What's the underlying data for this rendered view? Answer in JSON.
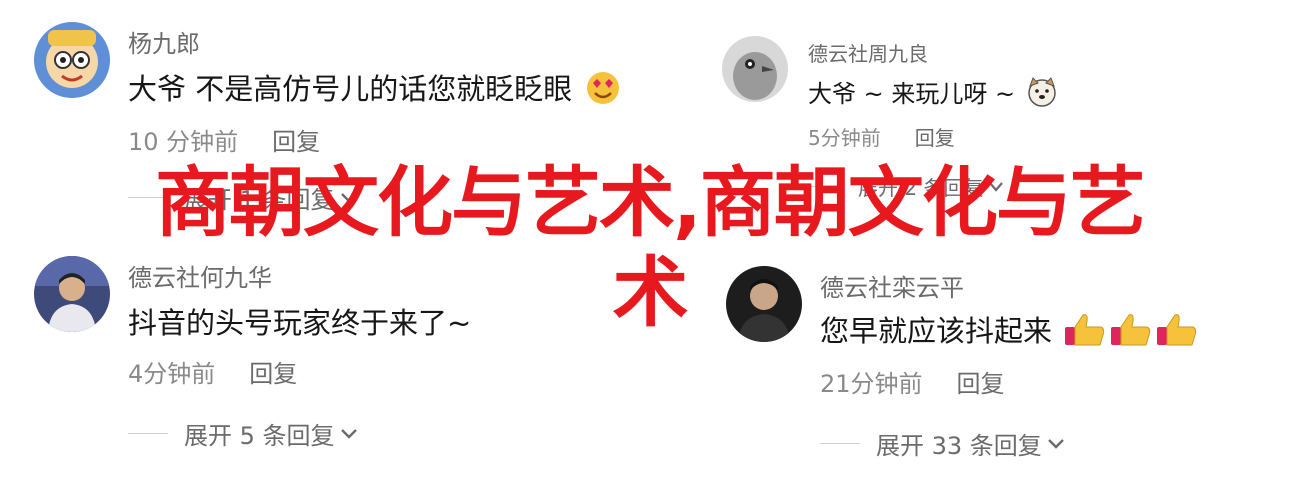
{
  "comments": [
    {
      "username": "杨九郎",
      "text": "大爷 不是高仿号儿的话您就眨眨眼",
      "emoji": "heart-eyes-emoji",
      "time": "10 分钟前",
      "reply": "回复",
      "expand": "展开 1 条回复"
    },
    {
      "username": "德云社周九良",
      "text": "大爷 ~ 来玩儿呀 ~",
      "emoji": "dog-face-emoji",
      "time": "5分钟前",
      "reply": "回复",
      "expand": "展开 2 条回复"
    },
    {
      "username": "德云社何九华",
      "text": "抖音的头号玩家终于来了~",
      "time": "4分钟前",
      "reply": "回复",
      "expand": "展开 5 条回复"
    },
    {
      "username": "德云社栾云平",
      "text": "您早就应该抖起来",
      "emoji": "thumbs-up-emoji",
      "time": "21分钟前",
      "reply": "回复",
      "expand": "展开 33 条回复"
    }
  ],
  "overlay": {
    "line1": "商朝文化与艺术,商朝文化与艺",
    "line2": "术"
  },
  "colors": {
    "overlay": "#e8191e",
    "username": "#6b6b6b",
    "text": "#161616",
    "meta": "#8a8a8a"
  }
}
